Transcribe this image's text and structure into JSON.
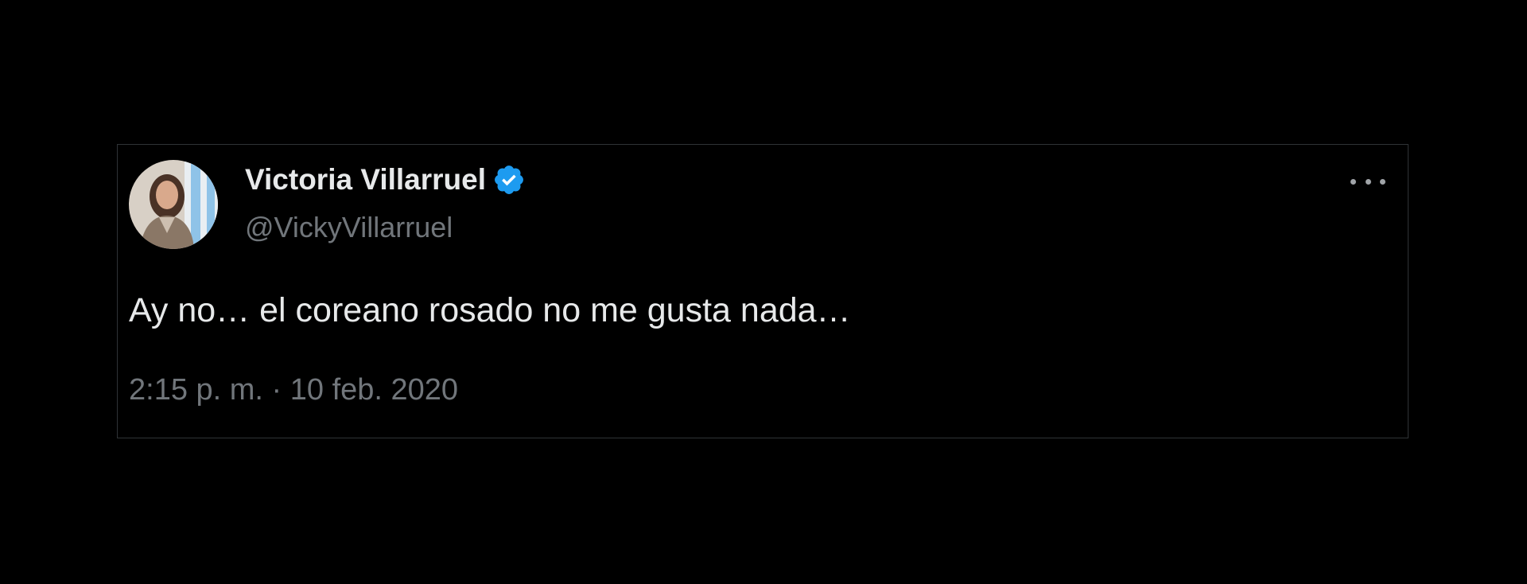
{
  "tweet": {
    "author": {
      "display_name": "Victoria Villarruel",
      "handle": "@VickyVillarruel",
      "verified": true,
      "verified_color": "#1d9bf0"
    },
    "text": "Ay no… el coreano rosado no me gusta nada…",
    "timestamp": "2:15 p. m. · 10 feb. 2020",
    "more_icon": "more-horizontal-icon"
  },
  "theme": {
    "background": "#000000",
    "primary_text": "#e7e9ea",
    "secondary_text": "#71767b",
    "border": "#2f3336"
  }
}
